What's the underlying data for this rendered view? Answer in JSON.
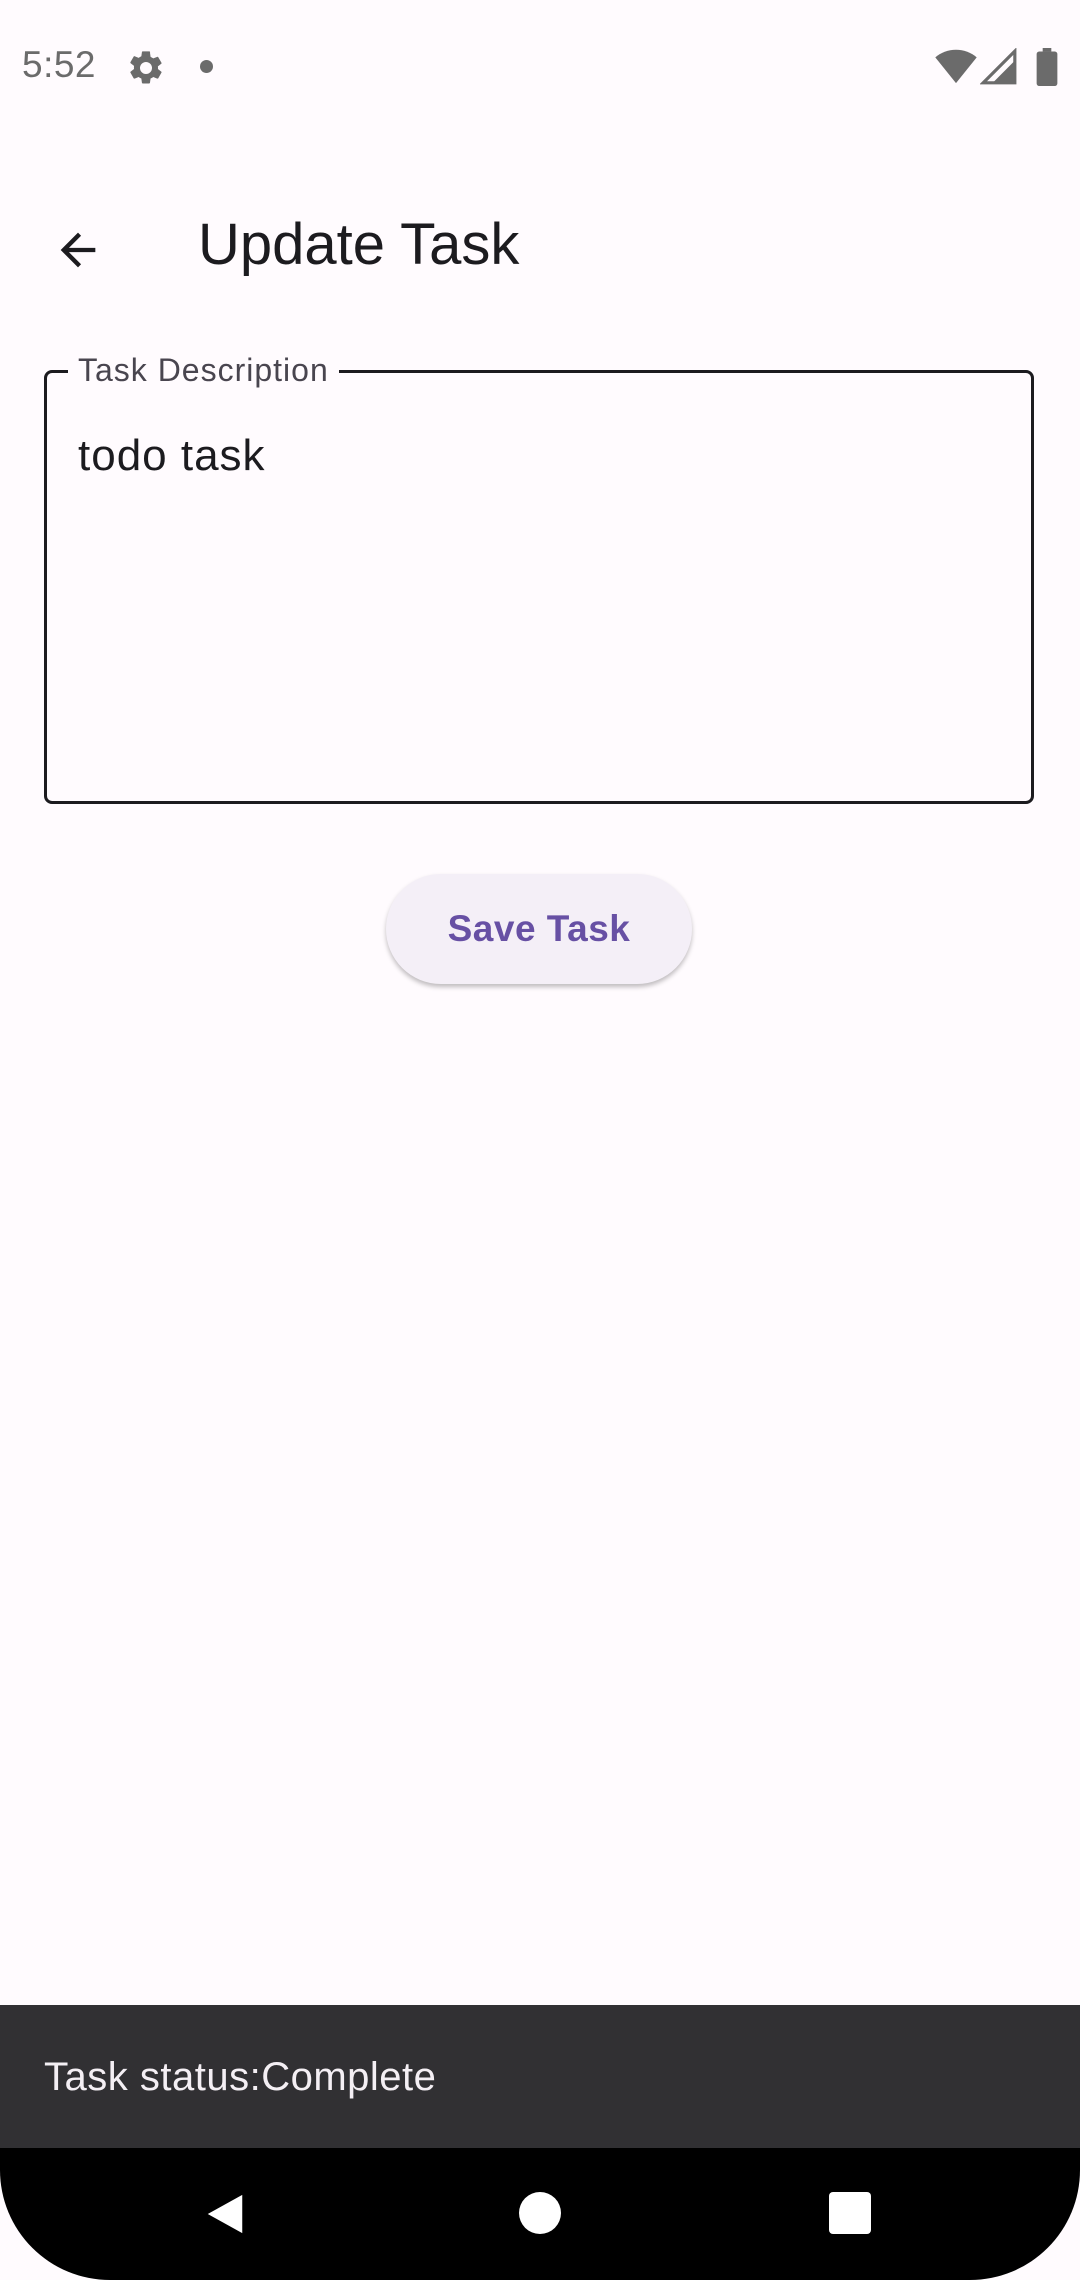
{
  "status_bar": {
    "time": "5:52",
    "icons": [
      "gear-icon",
      "notification-dot-icon",
      "wifi-icon",
      "cellular-signal-icon",
      "battery-icon"
    ]
  },
  "app_bar": {
    "back_icon": "arrow-left-icon",
    "title": "Update Task"
  },
  "form": {
    "description_label": "Task Description",
    "description_value": "todo task",
    "save_label": "Save Task"
  },
  "snackbar": {
    "message": "Task status:Complete"
  },
  "nav_bar": {
    "icons": [
      "nav-back-icon",
      "nav-home-icon",
      "nav-recents-icon"
    ]
  },
  "colors": {
    "background": "#fffbfe",
    "primary": "#6750a4",
    "button_surface": "#f4eff7",
    "snackbar_surface": "#313033",
    "text": "#1c1b1f"
  }
}
